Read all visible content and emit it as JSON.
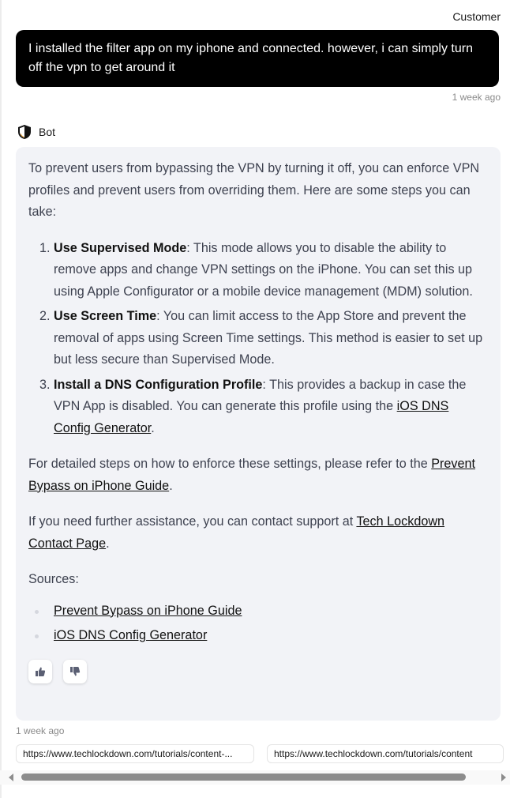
{
  "customer": {
    "label": "Customer",
    "message": "I installed the filter app on my iphone and connected. however, i can simply turn off the vpn to get around it",
    "time": "1 week ago"
  },
  "bot": {
    "name": "Bot",
    "icon": "shield-icon",
    "intro": "To prevent users from bypassing the VPN by turning it off, you can enforce VPN profiles and prevent users from overriding them. Here are some steps you can take:",
    "steps": [
      {
        "title": "Use Supervised Mode",
        "text": ": This mode allows you to disable the ability to remove apps and change VPN settings on the iPhone. You can set this up using Apple Configurator or a mobile device management (MDM) solution."
      },
      {
        "title": "Use Screen Time",
        "text": ": You can limit access to the App Store and prevent the removal of apps using Screen Time settings. This method is easier to set up but less secure than Supervised Mode."
      },
      {
        "title": "Install a DNS Configuration Profile",
        "text": ": This provides a backup in case the VPN App is disabled. You can generate this profile using the ",
        "link": "iOS DNS Config Generator",
        "after": "."
      }
    ],
    "detail_text": "For detailed steps on how to enforce these settings, please refer to the ",
    "detail_link": "Prevent Bypass on iPhone Guide",
    "detail_after": ".",
    "support_text": "If you need further assistance, you can contact support at ",
    "support_link": "Tech Lockdown Contact Page",
    "support_after": ".",
    "sources_label": "Sources:",
    "sources": [
      "Prevent Bypass on iPhone Guide",
      "iOS DNS Config Generator"
    ],
    "feedback": {
      "up": "thumbs-up-icon",
      "down": "thumbs-down-icon"
    },
    "time": "1 week ago"
  },
  "chips": [
    "https://www.techlockdown.com/tutorials/content-...",
    "https://www.techlockdown.com/tutorials/content"
  ]
}
